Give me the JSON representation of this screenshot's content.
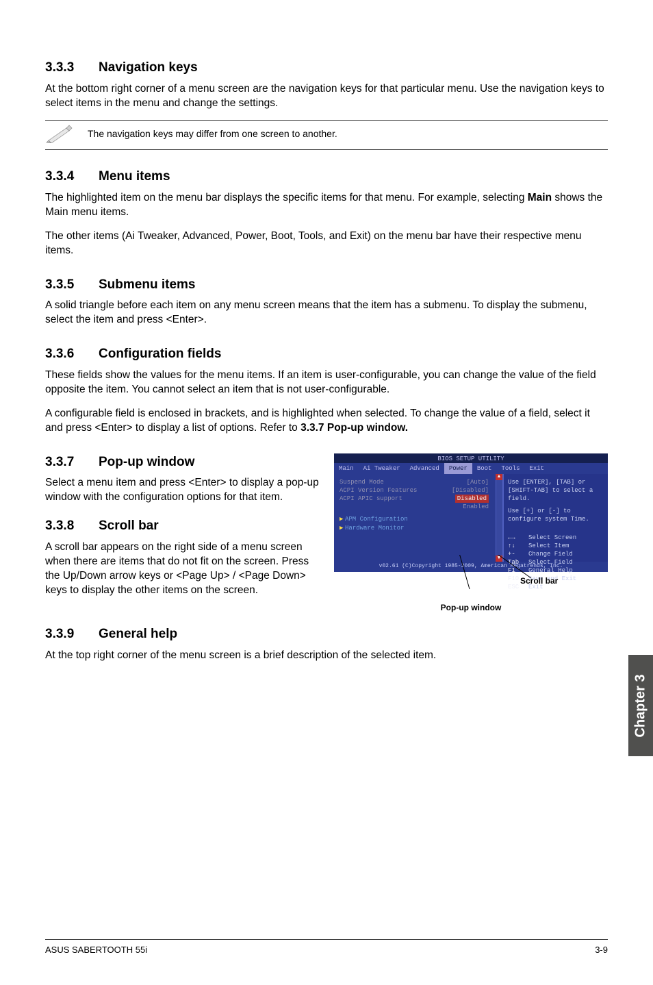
{
  "sec333": {
    "num": "3.3.3",
    "title": "Navigation keys",
    "p": "At the bottom right corner of a menu screen are the navigation keys for that particular menu. Use the navigation keys to select items in the menu and change the settings.",
    "note": "The navigation keys may differ from one screen to another."
  },
  "sec334": {
    "num": "3.3.4",
    "title": "Menu items",
    "p1_a": "The highlighted item on the menu bar displays the specific items for that menu. For example, selecting ",
    "p1_b": "Main",
    "p1_c": " shows the Main menu items.",
    "p2": "The other items (Ai Tweaker, Advanced, Power, Boot, Tools, and Exit) on the menu bar have their respective menu items."
  },
  "sec335": {
    "num": "3.3.5",
    "title": "Submenu items",
    "p": "A solid triangle before each item on any menu screen means that the item has a submenu. To display the submenu, select the item and press <Enter>."
  },
  "sec336": {
    "num": "3.3.6",
    "title": "Configuration fields",
    "p1": "These fields show the values for the menu items. If an item is user-configurable, you can change the value of the field opposite the item. You cannot select an item that is not user-configurable.",
    "p2_a": "A configurable field is enclosed in brackets, and is highlighted when selected. To change the value of a field, select it and press <Enter> to display a list of options. Refer to ",
    "p2_b": "3.3.7 Pop-up window."
  },
  "sec337": {
    "num": "3.3.7",
    "title": "Pop-up window",
    "p": "Select a menu item and press <Enter> to display a pop-up window with the configuration options for that item."
  },
  "sec338": {
    "num": "3.3.8",
    "title": "Scroll bar",
    "p": "A scroll bar appears on the right side of a menu screen when there are items that do not fit on the screen. Press the Up/Down arrow keys or <Page Up> / <Page Down> keys to display the other items on the screen."
  },
  "sec339": {
    "num": "3.3.9",
    "title": "General help",
    "p": "At the top right corner of the menu screen is a brief description of the selected item."
  },
  "bios": {
    "title": "BIOS SETUP UTILITY",
    "menu": [
      "Main",
      "Ai Tweaker",
      "Advanced",
      "Power",
      "Boot",
      "Tools",
      "Exit"
    ],
    "rows": [
      {
        "label": "Suspend Mode",
        "val": "[Auto]",
        "cls": "grey"
      },
      {
        "label": "ACPI Version Features",
        "val": "[Disabled]",
        "cls": "grey"
      },
      {
        "label": "ACPI APIC support",
        "val": "Disabled",
        "cls": "white"
      },
      {
        "label": "",
        "val": "Enabled",
        "cls": "grey"
      }
    ],
    "sub1": "APM Configuration",
    "sub2": "Hardware Monitor",
    "help1": "Use [ENTER], [TAB] or [SHIFT-TAB] to select a field.",
    "help2": "Use [+] or [-] to configure system Time.",
    "keys": [
      {
        "k": "←→",
        "t": "Select Screen"
      },
      {
        "k": "↑↓",
        "t": "Select Item"
      },
      {
        "k": "+-",
        "t": "Change Field"
      },
      {
        "k": "Tab",
        "t": "Select Field"
      },
      {
        "k": "F1",
        "t": "General Help"
      },
      {
        "k": "F10",
        "t": "Save and Exit"
      },
      {
        "k": "ESC",
        "t": "Exit"
      }
    ],
    "copyright": "v02.61 (C)Copyright 1985-2009, American Megatrends, Inc.",
    "scroll_label": "Scroll bar",
    "popup_label": "Pop-up window"
  },
  "sidetab": "Chapter 3",
  "footer_left": "ASUS SABERTOOTH 55i",
  "footer_right": "3-9"
}
